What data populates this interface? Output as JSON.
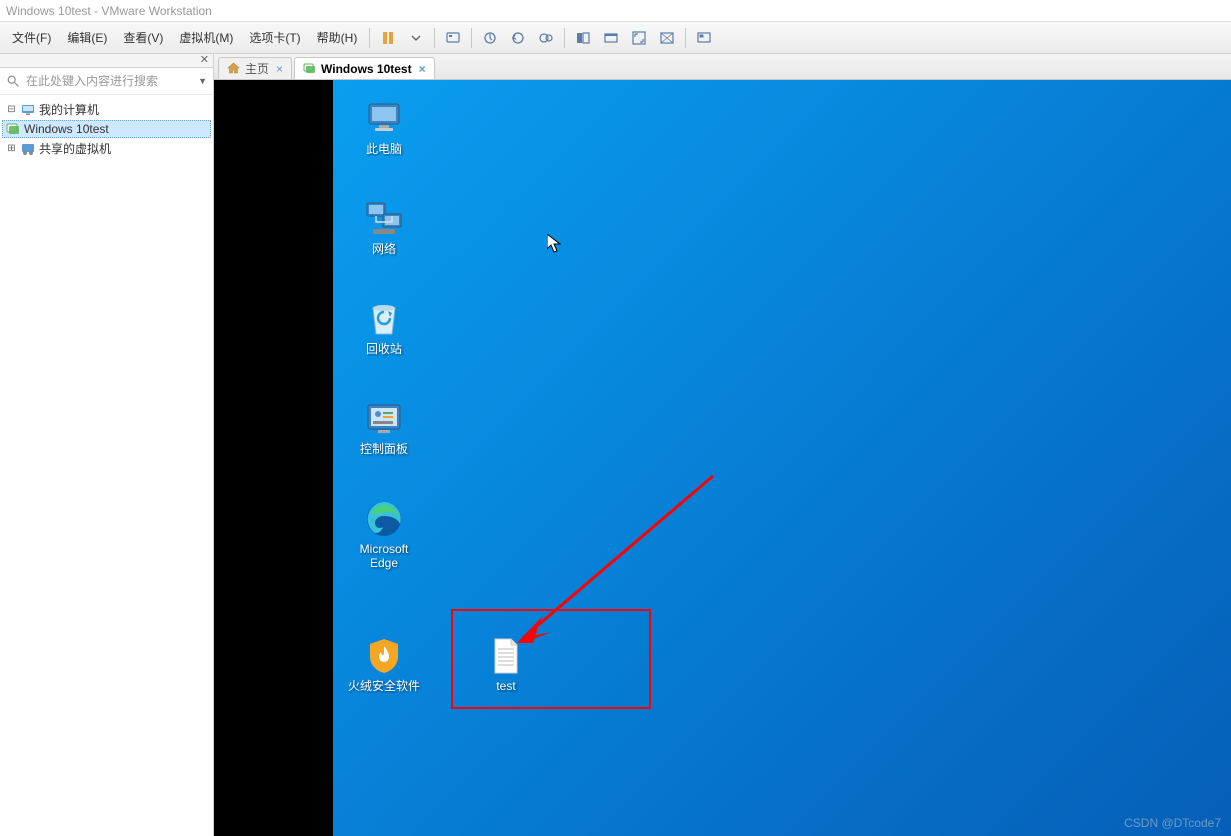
{
  "title": "Windows 10test - VMware Workstation",
  "menubar": {
    "file": "文件(F)",
    "edit": "编辑(E)",
    "view": "查看(V)",
    "vm": "虚拟机(M)",
    "tabs": "选项卡(T)",
    "help": "帮助(H)"
  },
  "sidebar": {
    "search_placeholder": "在此处键入内容进行搜索",
    "tree": {
      "my_computer": "我的计算机",
      "vm_item": "Windows 10test",
      "shared_vms": "共享的虚拟机"
    }
  },
  "tabs": {
    "home": "主页",
    "vm": "Windows 10test"
  },
  "desktop_icons": {
    "this_pc": "此电脑",
    "network": "网络",
    "recycle_bin": "回收站",
    "control_panel": "控制面板",
    "edge": "Microsoft Edge",
    "huorong": "火绒安全软件",
    "test_file": "test"
  },
  "watermark": "CSDN @DTcode7"
}
